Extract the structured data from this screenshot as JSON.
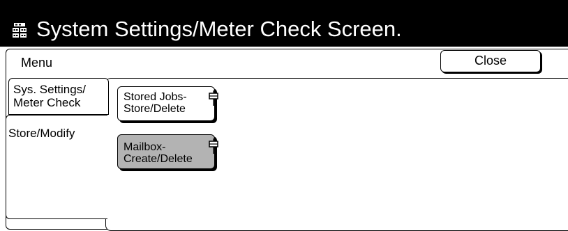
{
  "header": {
    "title": "System Settings/Meter Check Screen.",
    "icon": "system-settings-icon"
  },
  "menu": {
    "label": "Menu",
    "close_label": "Close"
  },
  "tabs": [
    {
      "label_line1": "Sys. Settings/",
      "label_line2": "Meter Check",
      "active": false
    },
    {
      "label_line1": "Store/Modify",
      "active": true
    }
  ],
  "buttons": [
    {
      "label_line1": "Stored Jobs-",
      "label_line2": "Store/Delete",
      "icon": "document-icon",
      "selected": false
    },
    {
      "label_line1": "Mailbox-",
      "label_line2": "Create/Delete",
      "icon": "document-icon",
      "selected": true
    }
  ],
  "colors": {
    "titlebar_bg": "#000000",
    "selected_button_bg": "#b3b3b3"
  }
}
